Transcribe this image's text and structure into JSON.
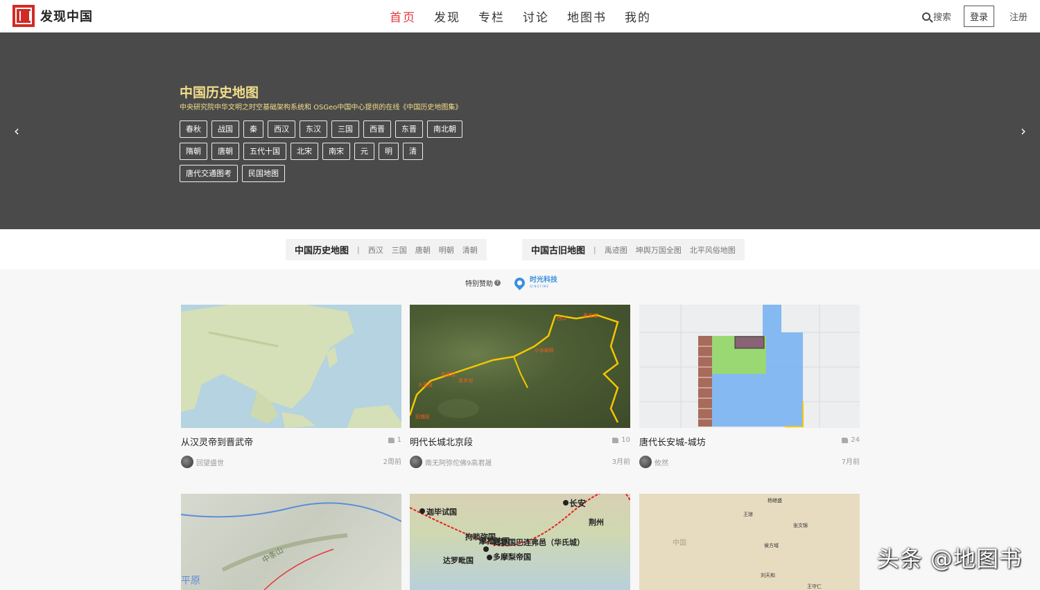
{
  "header": {
    "logo_text": "发现中国",
    "nav": [
      "首页",
      "发现",
      "专栏",
      "讨论",
      "地图书",
      "我的"
    ],
    "search_label": "搜索",
    "login_label": "登录",
    "register_label": "注册"
  },
  "banner": {
    "title": "中国历史地图",
    "subtitle": "中央研究院中华文明之时空基础架构系统和 OSGeo中国中心提供的在线《中国历史地图集》",
    "tag_rows": [
      [
        "春秋",
        "战国",
        "秦",
        "西汉",
        "东汉",
        "三国",
        "西晋",
        "东晋",
        "南北朝"
      ],
      [
        "隋朝",
        "唐朝",
        "五代十国",
        "北宋",
        "南宋",
        "元",
        "明",
        "清"
      ],
      [
        "唐代交通图考",
        "民国地图"
      ]
    ],
    "prev_arrow": "‹",
    "next_arrow": "›"
  },
  "subnav": [
    {
      "title": "中国历史地图",
      "links": [
        "西汉",
        "三国",
        "唐朝",
        "明朝",
        "清朝"
      ]
    },
    {
      "title": "中国古旧地图",
      "links": [
        "禹迹图",
        "坤舆万国全图",
        "北平风俗地图"
      ]
    }
  ],
  "sponsor": {
    "label": "特别赞助",
    "help": "?",
    "name_cn": "时光科技",
    "name_en": "QINGTIME"
  },
  "cards": [
    {
      "title": "从汉灵帝到晋武帝",
      "likes": "1",
      "author": "回望盛世",
      "time": "2周前",
      "map": "asia"
    },
    {
      "title": "明代长城北京段",
      "likes": "10",
      "author": "南无阿弥佗佛9高君晟",
      "time": "3月前",
      "map": "satellite"
    },
    {
      "title": "唐代长安城-城坊",
      "likes": "24",
      "author": "攸然",
      "time": "7月前",
      "map": "city"
    }
  ],
  "map_labels": {
    "sat": [
      "西口",
      "黄花城",
      "小水峪段",
      "花家窑",
      "大营盘",
      "青羊沟",
      "旧城段"
    ],
    "india": [
      "长安",
      "荆州",
      "迦毕试国",
      "拘睒弥国",
      "摩揭陀国",
      "揭提国巴连弗邑（华氏城）",
      "多摩梨帝国",
      "达罗毗国"
    ],
    "terrain": [
      "中条山",
      "平原"
    ],
    "plain": [
      "王琼",
      "张文锦",
      "杨继盛",
      "侯方域",
      "刘天和",
      "王守仁",
      "中国"
    ]
  },
  "watermark": "头条 @地图书"
}
